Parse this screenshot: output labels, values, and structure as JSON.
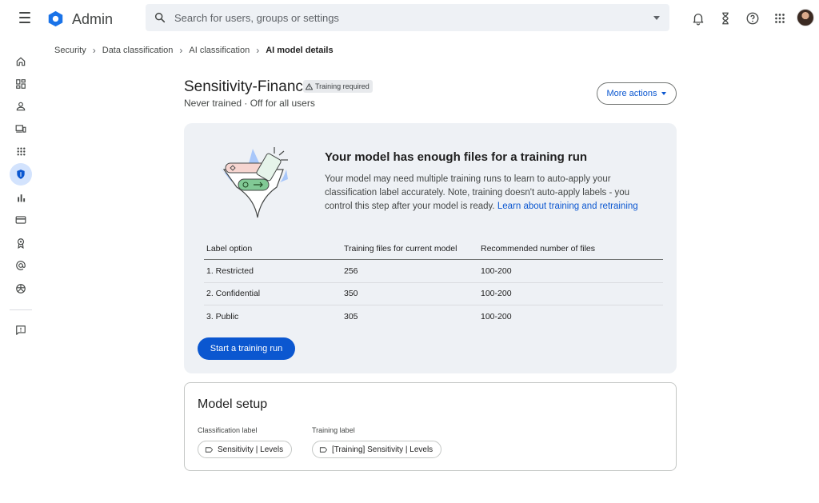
{
  "app": {
    "title": "Admin"
  },
  "search": {
    "placeholder": "Search for users, groups or settings"
  },
  "breadcrumb": {
    "items": [
      "Security",
      "Data classification",
      "AI classification"
    ],
    "current": "AI model details"
  },
  "header": {
    "title": "Sensitivity-Finance",
    "badge": "Training required",
    "subtitle": "Never trained · Off for all users",
    "more_actions": "More actions"
  },
  "training": {
    "heading": "Your model has enough files for a training run",
    "body": "Your model may need multiple training runs to learn to auto-apply your classification label accurately. Note, training doesn't auto-apply labels - you control this step after your model is ready.",
    "link": "Learn about training and retraining",
    "table": {
      "headers": [
        "Label option",
        "Training files for current model",
        "Recommended number of files"
      ],
      "rows": [
        [
          "1. Restricted",
          "256",
          "100-200"
        ],
        [
          "2. Confidential",
          "350",
          "100-200"
        ],
        [
          "3. Public",
          "305",
          "100-200"
        ]
      ]
    },
    "start_button": "Start a training run"
  },
  "setup": {
    "title": "Model setup",
    "classification_label_caption": "Classification label",
    "classification_label_value": "Sensitivity | Levels",
    "training_label_caption": "Training label",
    "training_label_value": "[Training] Sensitivity | Levels"
  },
  "colors": {
    "accent": "#0b57d0",
    "card_bg": "#eef1f5",
    "active_nav": "#d3e3fd"
  },
  "icons": {
    "sidebar": [
      "home-icon",
      "dashboard-icon",
      "person-icon",
      "devices-icon",
      "apps-icon",
      "shield-icon",
      "reports-icon",
      "billing-icon",
      "rules-icon",
      "at-sign-icon",
      "globe-icon",
      "feedback-icon"
    ],
    "topbar": [
      "bell-icon",
      "hourglass-icon",
      "help-icon",
      "apps-grid-icon"
    ]
  }
}
